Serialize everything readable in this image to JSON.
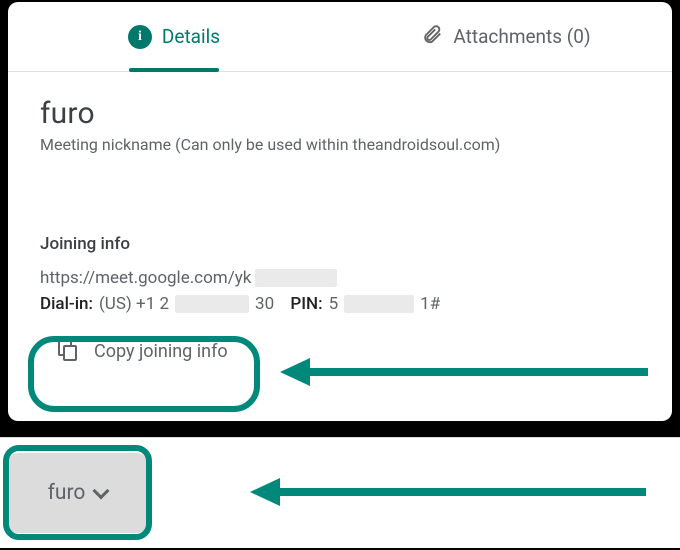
{
  "tabs": {
    "details": "Details",
    "attachments": "Attachments (0)"
  },
  "meeting": {
    "nickname": "furo",
    "subtext": "Meeting nickname (Can only be used within theandroidsoul.com)"
  },
  "joining": {
    "title": "Joining info",
    "link_prefix": "https://meet.google.com/yk",
    "dial_label": "Dial-in:",
    "dial_prefix": "(US) +1 2",
    "dial_mid": "30",
    "pin_label": "PIN:",
    "pin_prefix": "5",
    "pin_suffix": "1#",
    "copy_label": "Copy joining info"
  },
  "chip": {
    "label": "furo"
  }
}
